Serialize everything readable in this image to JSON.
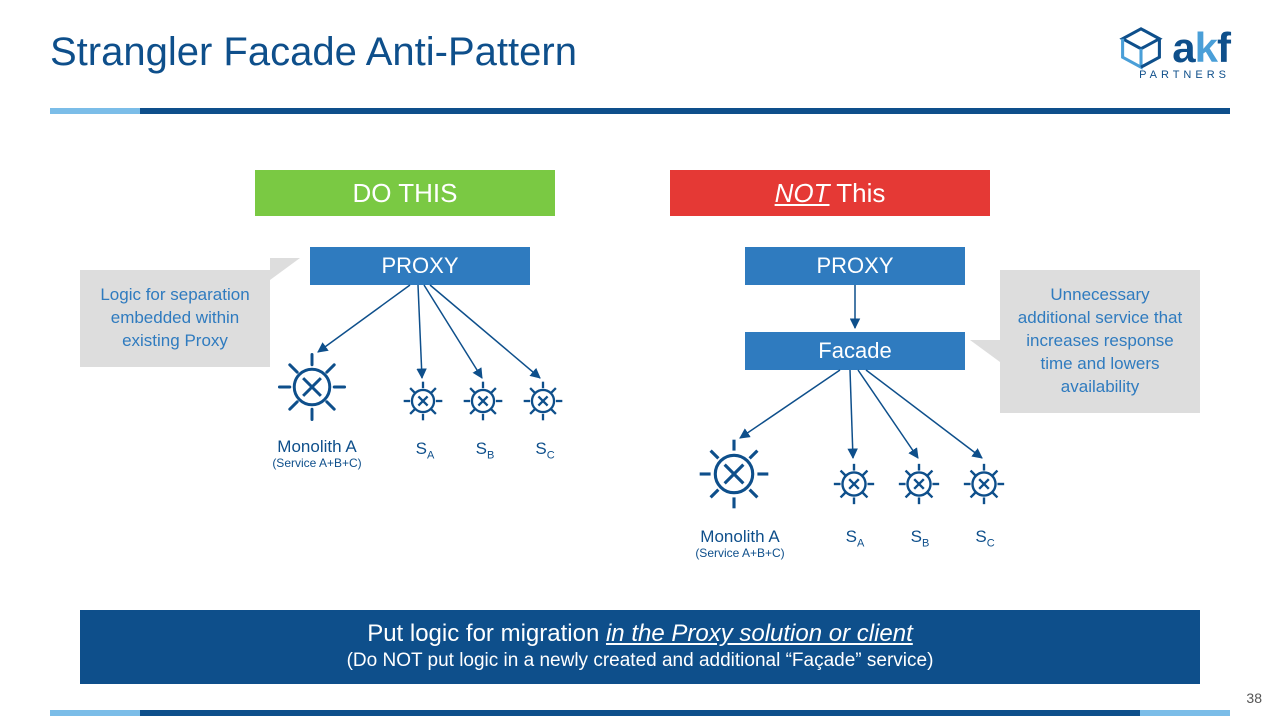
{
  "title": "Strangler Facade Anti-Pattern",
  "logo": {
    "brand_a": "a",
    "brand_k": "k",
    "brand_f": "f",
    "partners": "PARTNERS"
  },
  "banner": {
    "do_label": "DO THIS",
    "not_prefix": "NOT",
    "not_suffix": " This"
  },
  "boxes": {
    "proxy": "PROXY",
    "facade": "Facade"
  },
  "notes": {
    "left": "Logic for separation embedded  within existing Proxy",
    "right": "Unnecessary additional service that increases response time and lowers availability"
  },
  "labels": {
    "monolith": "Monolith A",
    "monolith_sub": "(Service A+B+C)",
    "sa": "S",
    "sa_sub": "A",
    "sb": "S",
    "sb_sub": "B",
    "sc": "S",
    "sc_sub": "C"
  },
  "footer": {
    "line1_a": "Put logic for migration ",
    "line1_b": "in the Proxy solution or client",
    "line2": "(Do NOT put logic in a newly created and additional “Façade” service)"
  },
  "page": "38"
}
